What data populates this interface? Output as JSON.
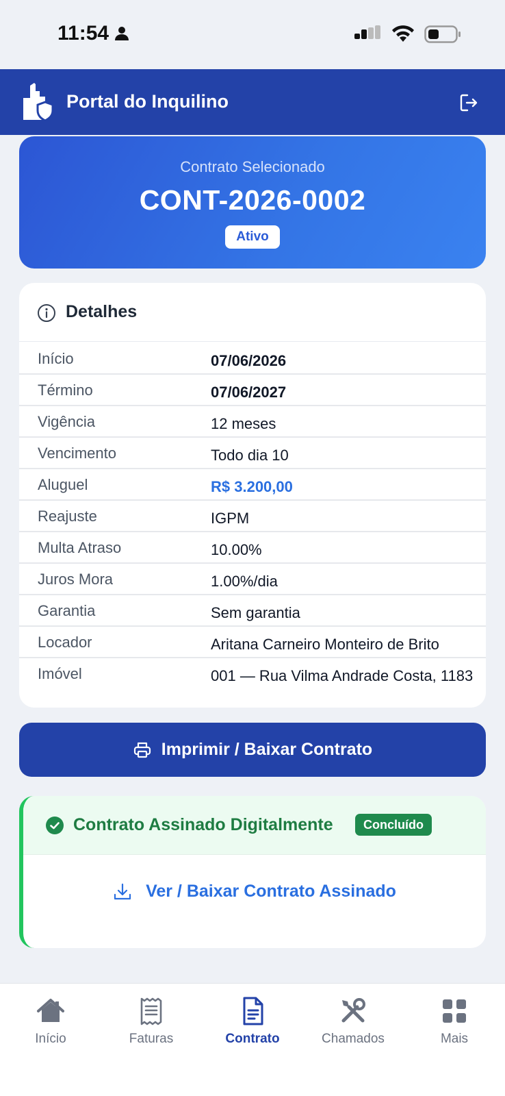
{
  "status_bar": {
    "time": "11:54"
  },
  "header": {
    "title": "Portal do Inquilino"
  },
  "contract": {
    "caption": "Contrato Selecionado",
    "number": "CONT-2026-0002",
    "status": "Ativo"
  },
  "details": {
    "title": "Detalhes",
    "rows": [
      {
        "label": "Início",
        "value": "07/06/2026"
      },
      {
        "label": "Término",
        "value": "07/06/2027"
      },
      {
        "label": "Vigência",
        "value": "12 meses"
      },
      {
        "label": "Vencimento",
        "value": "Todo dia 10"
      },
      {
        "label": "Aluguel",
        "value": "R$ 3.200,00"
      },
      {
        "label": "Reajuste",
        "value": "IGPM"
      },
      {
        "label": "Multa Atraso",
        "value": "10.00%"
      },
      {
        "label": "Juros Mora",
        "value": "1.00%/dia"
      },
      {
        "label": "Garantia",
        "value": "Sem garantia"
      },
      {
        "label": "Locador",
        "value": "Aritana Carneiro Monteiro de Brito"
      },
      {
        "label": "Imóvel",
        "value": "001 — Rua Vilma Andrade Costa, 1183"
      }
    ]
  },
  "print_button": {
    "label": "Imprimir / Baixar Contrato"
  },
  "signed": {
    "title": "Contrato Assinado Digitalmente",
    "badge": "Concluído",
    "download_label": "Ver / Baixar Contrato Assinado"
  },
  "nav": {
    "items": [
      {
        "label": "Início",
        "icon": "home-icon"
      },
      {
        "label": "Faturas",
        "icon": "invoice-icon"
      },
      {
        "label": "Contrato",
        "icon": "document-icon",
        "active": true
      },
      {
        "label": "Chamados",
        "icon": "tools-icon"
      },
      {
        "label": "Mais",
        "icon": "grid-icon"
      }
    ]
  },
  "colors": {
    "header": "#2342a8",
    "accent_blue": "#2a6fe0",
    "success": "#1f8a4d",
    "success_border": "#22c55e"
  }
}
